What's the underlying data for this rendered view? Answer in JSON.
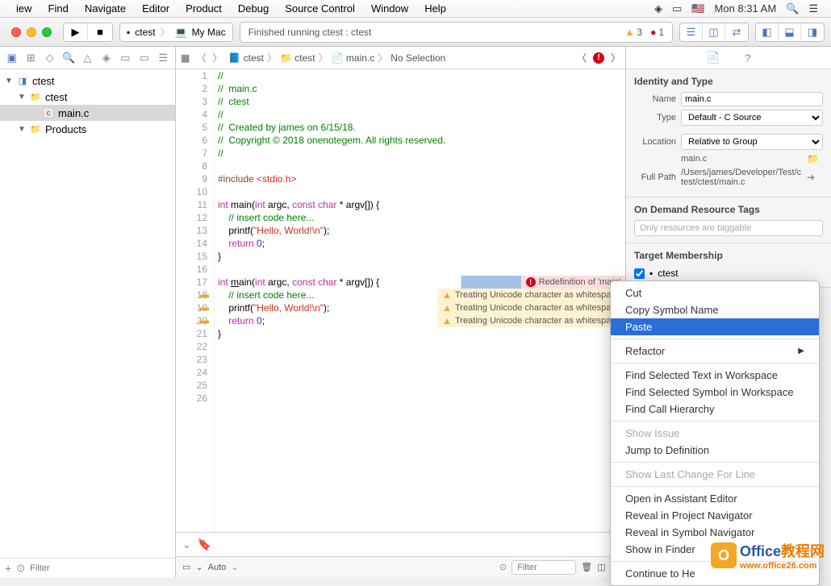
{
  "menubar": {
    "items": [
      "iew",
      "Find",
      "Navigate",
      "Editor",
      "Product",
      "Debug",
      "Source Control",
      "Window",
      "Help"
    ],
    "clock": "Mon 8:31 AM"
  },
  "toolbar": {
    "scheme": {
      "target": "ctest",
      "device": "My Mac"
    },
    "activity": "Finished running ctest : ctest",
    "warn_count": "3",
    "err_count": "1"
  },
  "navigator": {
    "tree": [
      {
        "label": "ctest",
        "type": "project",
        "indent": 0
      },
      {
        "label": "ctest",
        "type": "folder",
        "indent": 1
      },
      {
        "label": "main.c",
        "type": "cfile",
        "indent": 2,
        "selected": true
      },
      {
        "label": "Products",
        "type": "folder",
        "indent": 1
      }
    ],
    "filter_placeholder": "Filter"
  },
  "jumpbar": {
    "items": [
      "ctest",
      "ctest",
      "main.c",
      "No Selection"
    ]
  },
  "code_lines": [
    {
      "n": 1,
      "html": "<span class='comment'>//</span>"
    },
    {
      "n": 2,
      "html": "<span class='comment'>//  main.c</span>"
    },
    {
      "n": 3,
      "html": "<span class='comment'>//  ctest</span>"
    },
    {
      "n": 4,
      "html": "<span class='comment'>//</span>"
    },
    {
      "n": 5,
      "html": "<span class='comment'>//  Created by james on 6/15/18.</span>"
    },
    {
      "n": 6,
      "html": "<span class='comment'>//  Copyright © 2018 onenotegem. All rights reserved.</span>"
    },
    {
      "n": 7,
      "html": "<span class='comment'>//</span>"
    },
    {
      "n": 8,
      "html": ""
    },
    {
      "n": 9,
      "html": "<span class='pp'>#include </span><span class='include-lit'>&lt;stdio.h&gt;</span>"
    },
    {
      "n": 10,
      "html": ""
    },
    {
      "n": 11,
      "html": "<span class='keyword'>int</span> main(<span class='keyword'>int</span> argc, <span class='keyword'>const</span> <span class='keyword'>char</span> * argv[]) {"
    },
    {
      "n": 12,
      "html": "    <span class='comment'>// insert code here...</span>"
    },
    {
      "n": 13,
      "html": "    printf(<span class='string'>\"Hello, World!\\n\"</span>);"
    },
    {
      "n": 14,
      "html": "    <span class='keyword'>return</span> <span class='num'>0</span>;"
    },
    {
      "n": 15,
      "html": "}"
    },
    {
      "n": 16,
      "html": ""
    },
    {
      "n": 17,
      "html": "<span class='keyword'>int</span> <u>m</u>ain(<span class='keyword'>int</span> argc, <span class='keyword'>const</span> <span class='keyword'>char</span> * argv[]) {",
      "ann": {
        "type": "err",
        "text": "Redefinition of 'main'"
      },
      "hl": true
    },
    {
      "n": 18,
      "html": "    <span class='comment'>// insert code here...</span>",
      "ann": {
        "type": "warn",
        "text": "Treating Unicode character as whitespace"
      },
      "wg": true
    },
    {
      "n": 19,
      "html": "    printf(<span class='string'>\"Hello, World!\\n\"</span>);",
      "ann": {
        "type": "warn",
        "text": "Treating Unicode character as whitespace"
      },
      "wg": true
    },
    {
      "n": 20,
      "html": "    <span class='keyword'>return</span> <span class='num'>0</span>;",
      "ann": {
        "type": "warn",
        "text": "Treating Unicode character as whitespace"
      },
      "wg": true
    },
    {
      "n": 21,
      "html": "}"
    },
    {
      "n": 22,
      "html": ""
    },
    {
      "n": 23,
      "html": ""
    },
    {
      "n": 24,
      "html": ""
    },
    {
      "n": 25,
      "html": ""
    },
    {
      "n": 26,
      "html": ""
    }
  ],
  "editor_footer": {
    "auto": "Auto",
    "filter_placeholder": "Filter"
  },
  "inspector": {
    "identity": {
      "title": "Identity and Type",
      "name_label": "Name",
      "name": "main.c",
      "type_label": "Type",
      "type": "Default - C Source",
      "location_label": "Location",
      "location": "Relative to Group",
      "filename": "main.c",
      "fullpath_label": "Full Path",
      "fullpath": "/Users/james/Developer/Test/ctest/ctest/main.c"
    },
    "tags": {
      "title": "On Demand Resource Tags",
      "placeholder": "Only resources are taggable"
    },
    "membership": {
      "title": "Target Membership",
      "target": "ctest"
    }
  },
  "context_menu": [
    {
      "label": "Cut"
    },
    {
      "label": "Copy Symbol Name"
    },
    {
      "label": "Paste",
      "highlighted": true
    },
    {
      "sep": true
    },
    {
      "label": "Refactor",
      "submenu": true
    },
    {
      "sep": true
    },
    {
      "label": "Find Selected Text in Workspace"
    },
    {
      "label": "Find Selected Symbol in Workspace"
    },
    {
      "label": "Find Call Hierarchy"
    },
    {
      "sep": true
    },
    {
      "label": "Show Issue",
      "disabled": true
    },
    {
      "label": "Jump to Definition"
    },
    {
      "sep": true
    },
    {
      "label": "Show Last Change For Line",
      "disabled": true
    },
    {
      "sep": true
    },
    {
      "label": "Open in Assistant Editor"
    },
    {
      "label": "Reveal in Project Navigator"
    },
    {
      "label": "Reveal in Symbol Navigator"
    },
    {
      "label": "Show in Finder"
    },
    {
      "sep": true
    },
    {
      "label": "Continue to He"
    }
  ],
  "watermark": {
    "text1": "Office",
    "text2": "教程网",
    "url": "www.office26.com"
  }
}
